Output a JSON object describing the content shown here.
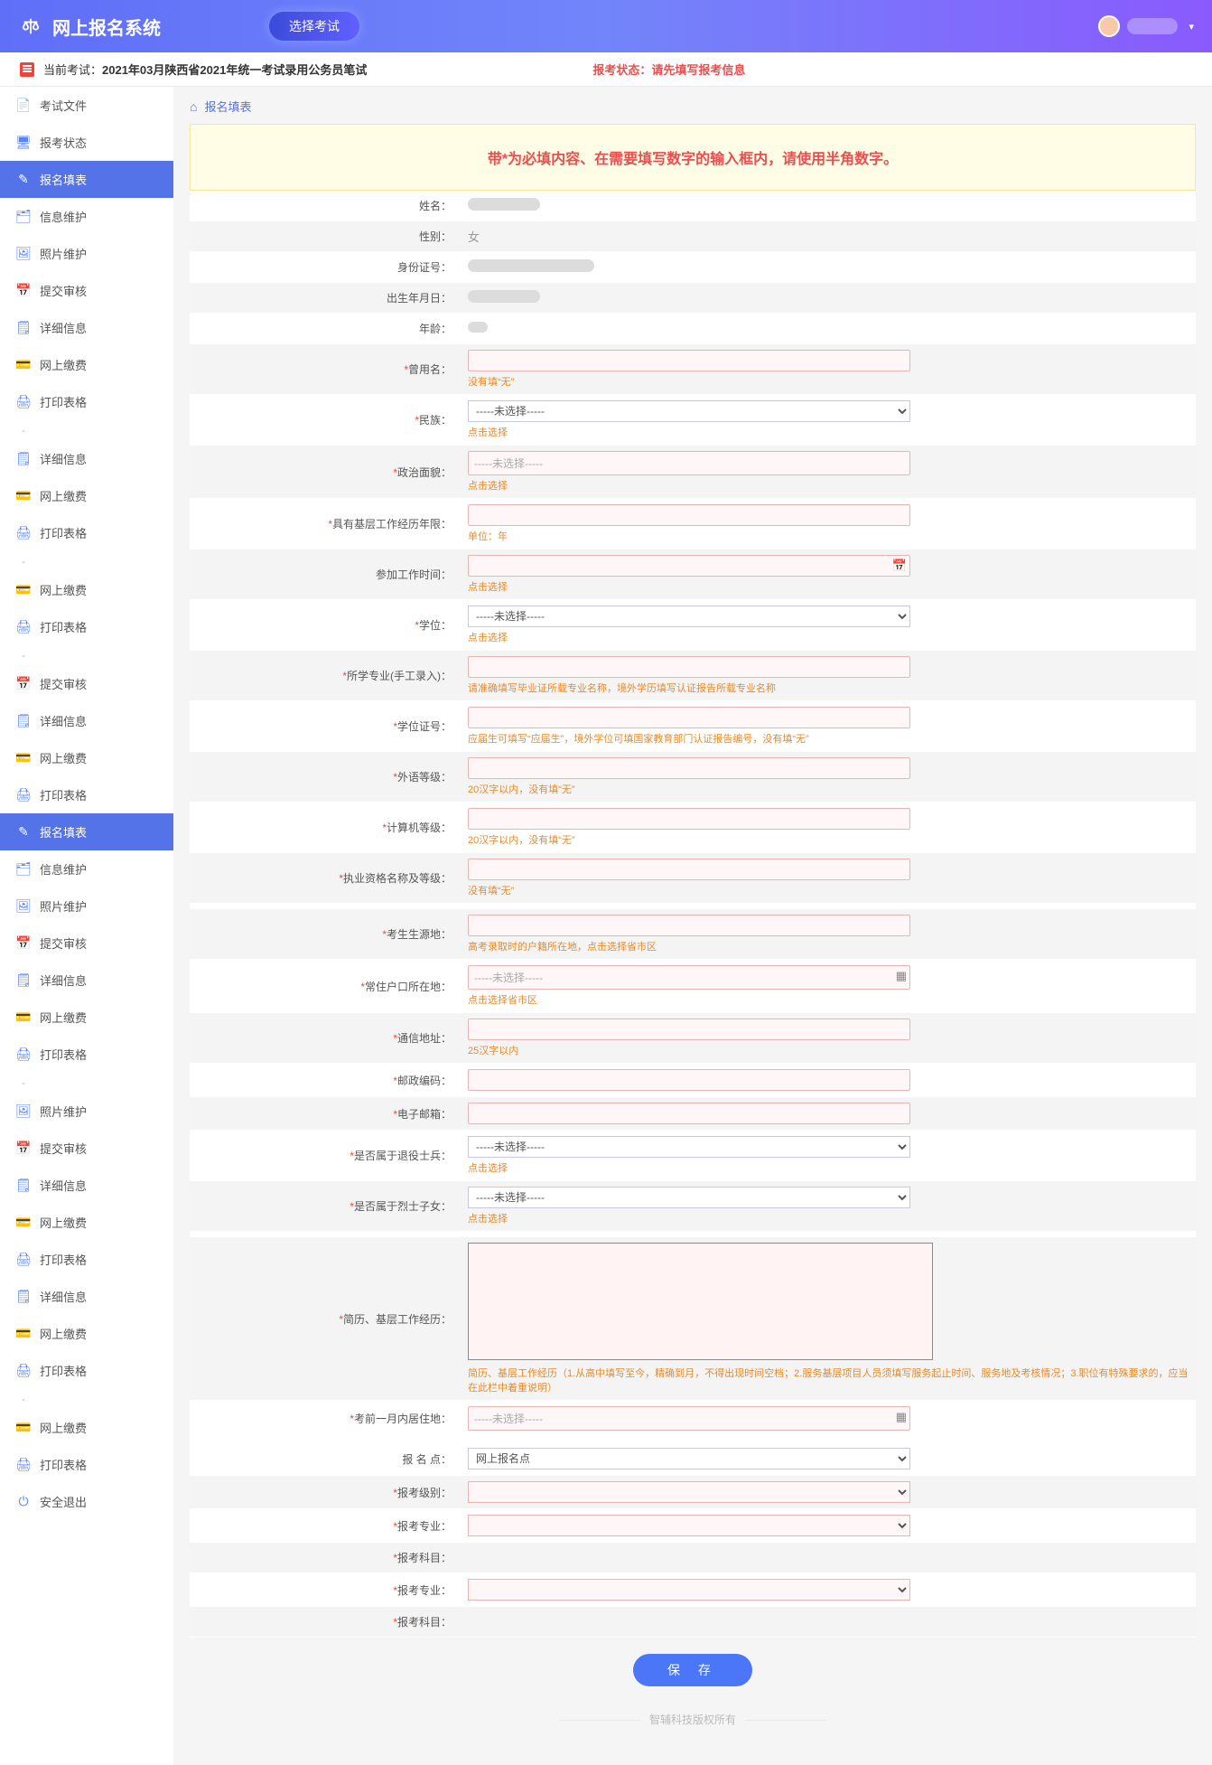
{
  "header": {
    "title": "网上报名系统",
    "select_exam": "选择考试"
  },
  "subbar": {
    "prefix": "当前考试：",
    "exam": "2021年03月陕西省2021年统一考试录用公务员笔试",
    "status_label": "报考状态：",
    "status_value": "请先填写报考信息"
  },
  "sidebar": [
    {
      "icon": "📄",
      "label": "考试文件"
    },
    {
      "icon": "🖥",
      "label": "报考状态"
    },
    {
      "icon": "✎",
      "label": "报名填表",
      "active": true
    },
    {
      "icon": "🗂",
      "label": "信息维护"
    },
    {
      "icon": "🖼",
      "label": "照片维护"
    },
    {
      "icon": "📅",
      "label": "提交审核"
    },
    {
      "icon": "🗒",
      "label": "详细信息"
    },
    {
      "icon": "💳",
      "label": "网上缴费"
    },
    {
      "icon": "🖨",
      "label": "打印表格"
    },
    {
      "dash": true
    },
    {
      "icon": "🗒",
      "label": "详细信息"
    },
    {
      "icon": "💳",
      "label": "网上缴费"
    },
    {
      "icon": "🖨",
      "label": "打印表格"
    },
    {
      "dash": true
    },
    {
      "icon": "💳",
      "label": "网上缴费"
    },
    {
      "icon": "🖨",
      "label": "打印表格"
    },
    {
      "dash": true
    },
    {
      "icon": "📅",
      "label": "提交审核"
    },
    {
      "icon": "🗒",
      "label": "详细信息"
    },
    {
      "icon": "💳",
      "label": "网上缴费"
    },
    {
      "icon": "🖨",
      "label": "打印表格"
    },
    {
      "icon": "✎",
      "label": "报名填表",
      "active2": true
    },
    {
      "icon": "🗂",
      "label": "信息维护"
    },
    {
      "icon": "🖼",
      "label": "照片维护"
    },
    {
      "icon": "📅",
      "label": "提交审核"
    },
    {
      "icon": "🗒",
      "label": "详细信息"
    },
    {
      "icon": "💳",
      "label": "网上缴费"
    },
    {
      "icon": "🖨",
      "label": "打印表格"
    },
    {
      "dash": true
    },
    {
      "icon": "🖼",
      "label": "照片维护"
    },
    {
      "icon": "📅",
      "label": "提交审核"
    },
    {
      "icon": "🗒",
      "label": "详细信息"
    },
    {
      "icon": "💳",
      "label": "网上缴费"
    },
    {
      "icon": "🖨",
      "label": "打印表格"
    },
    {
      "icon": "🗒",
      "label": "详细信息"
    },
    {
      "icon": "💳",
      "label": "网上缴费"
    },
    {
      "icon": "🖨",
      "label": "打印表格"
    },
    {
      "dash": true
    },
    {
      "icon": "💳",
      "label": "网上缴费"
    },
    {
      "icon": "🖨",
      "label": "打印表格"
    },
    {
      "icon": "⏻",
      "label": "安全退出"
    }
  ],
  "breadcrumb": "报名填表",
  "notice": "带*为必填内容、在需要填写数字的输入框内，请使用半角数字。",
  "labels": {
    "name": "姓名：",
    "gender": "性别：",
    "idno": "身份证号：",
    "birth": "出生年月日：",
    "age": "年龄：",
    "former_name": "*曾用名：",
    "ethnic": "*民族：",
    "politics": "*政治面貌：",
    "work_years": "*具有基层工作经历年限：",
    "join_time": "参加工作时间：",
    "degree": "*学位：",
    "major": "*所学专业(手工录入)：",
    "cert_no": "*学位证号：",
    "lang_level": "*外语等级：",
    "comp_level": "*计算机等级：",
    "prof_qual": "*执业资格名称及等级：",
    "origin": "*考生生源地：",
    "hukou": "*常住户口所在地：",
    "address": "*通信地址：",
    "postcode": "*邮政编码：",
    "email": "*电子邮箱：",
    "veteran": "*是否属于退役士兵：",
    "martyr": "*是否属于烈士子女：",
    "resume": "*简历、基层工作经历：",
    "resid_before": "*考前一月内居住地：",
    "reg_point": "报 名 点：",
    "exam_level": "*报考级别：",
    "exam_major": "*报考专业：",
    "exam_subj": "*报考科目：",
    "exam_major2": "*报考专业：",
    "exam_subj2": "*报考科目："
  },
  "values": {
    "gender": "女",
    "reg_point_opt": "网上报名点"
  },
  "opts": {
    "unselected": "-----未选择-----"
  },
  "hints": {
    "former_name": "没有填“无”",
    "ethnic": "点击选择",
    "politics": "点击选择",
    "work_years": "单位：年",
    "join_time": "点击选择",
    "degree": "点击选择",
    "major": "请准确填写毕业证所载专业名称，境外学历填写认证报告所载专业名称",
    "cert_no": "应届生可填写“应届生”，境外学位可填国家教育部门认证报告编号，没有填“无”",
    "lang_level": "20汉字以内，没有填“无”",
    "comp_level": "20汉字以内，没有填“无”",
    "prof_qual": "没有填“无”",
    "origin": "高考录取时的户籍所在地，点击选择省市区",
    "hukou": "点击选择省市区",
    "address": "25汉字以内",
    "veteran": "点击选择",
    "martyr": "点击选择",
    "resume": "简历、基层工作经历（1.从高中填写至今，精确到月，不得出现时间空档；2.服务基层项目人员须填写服务起止时间、服务地及考核情况；3.职位有特殊要求的，应当在此栏中着重说明）"
  },
  "save": "保 存",
  "footer": "智辅科技版权所有"
}
